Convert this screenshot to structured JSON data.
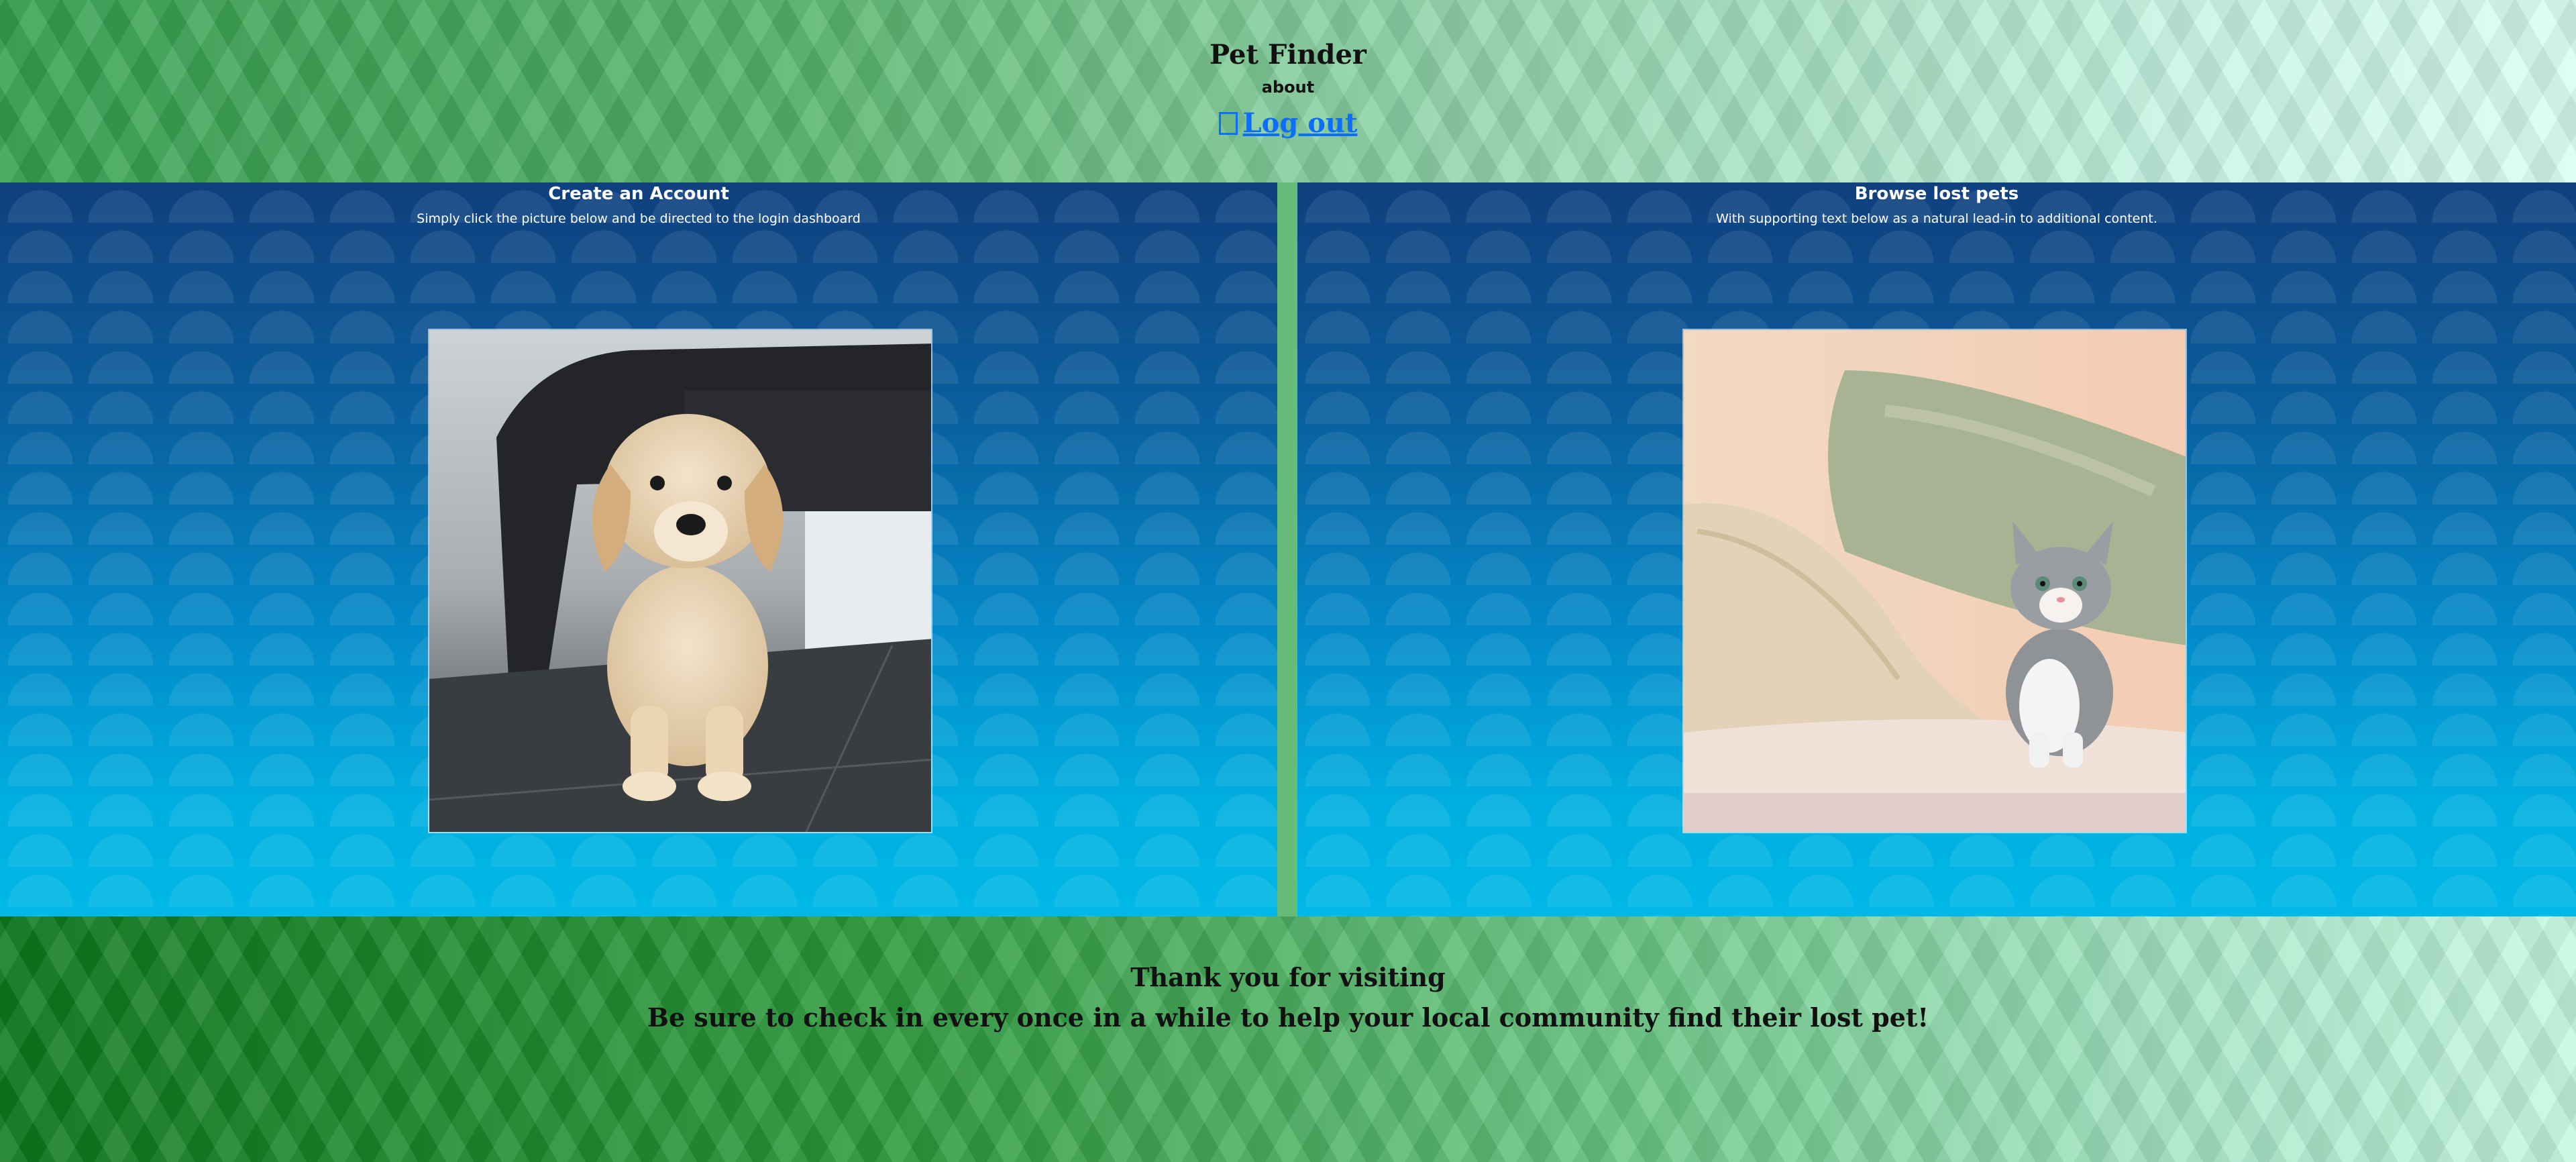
{
  "header": {
    "title": "Pet Finder",
    "about_label": "about",
    "logout_label": "Log out"
  },
  "cards": [
    {
      "title": "Create an Account",
      "subtitle": "Simply click the picture below and be directed to the login dashboard",
      "image_icon": "puppy-photo"
    },
    {
      "title": "Browse lost pets",
      "subtitle": "With supporting text below as a natural lead-in to additional content.",
      "image_icon": "kitten-photo"
    }
  ],
  "footer": {
    "line1": "Thank you for visiting",
    "line2": "Be sure to check in every once in a while to help your local community find their lost pet!"
  },
  "colors": {
    "link": "#0d6efd",
    "panel_top": "#0f3f7e",
    "panel_bottom": "#00b8e6",
    "header_green": "#55b46a",
    "footer_green": "#0e7a1e"
  }
}
